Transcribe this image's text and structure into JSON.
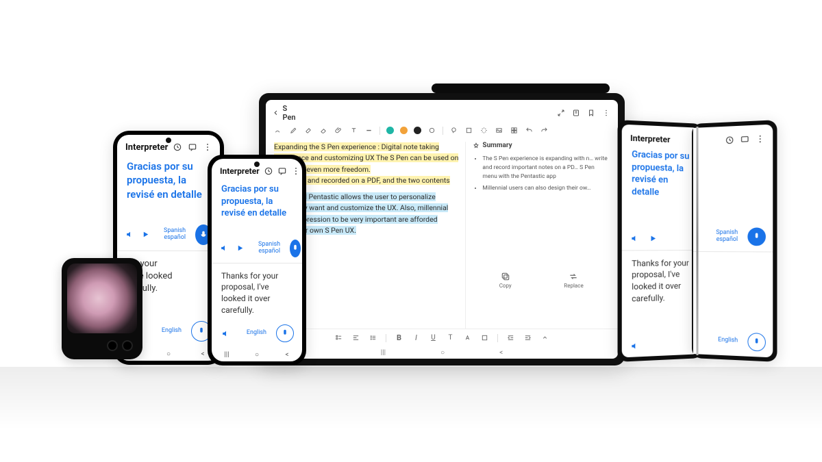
{
  "interpreter": {
    "title": "Interpreter",
    "source_text": "Gracias por su propuesta, la revisé en detalle",
    "target_text_short": "Thanks for your proposal, I've looked it over carefully.",
    "target_text_phoneA_visible": "for your\n, I've looked\narefully.",
    "src_lang_label": "Spanish\nespañol",
    "tgt_lang_label": "English"
  },
  "tablet": {
    "back_label": "S Pen",
    "paragraph1": "Expanding the S Pen experience : Digital note taking experience and customizing UX The S Pen can be used on Note with even more freedom.",
    "paragraph1b": "be written and recorded on a PDF, and the two contents",
    "paragraph2a": "app called Pentastic allows the user to personalize",
    "paragraph2b": "s that they want and customize the UX. Also, millennial",
    "paragraph2c": "rsonal expression to be very important are afforded",
    "paragraph2d": "gning their own S Pen UX.",
    "summary_title": "Summary",
    "summary_items": [
      "The S Pen experience is expanding with n… write and record important notes on a PD… S Pen menu with the Pentastic app",
      "Millennial users can also design their ow…"
    ],
    "actions": {
      "copy": "Copy",
      "replace": "Replace"
    },
    "colors": {
      "teal": "#1fb6a6",
      "orange": "#f2a23a",
      "dark": "#222222"
    }
  }
}
